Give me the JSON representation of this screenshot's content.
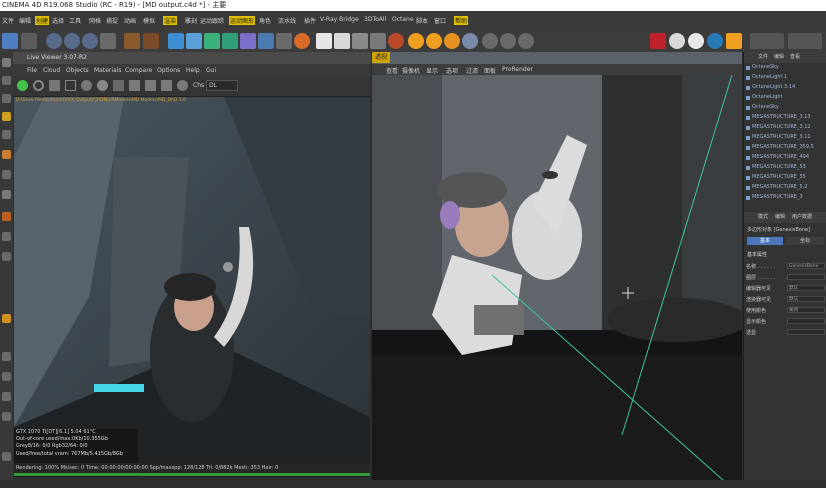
{
  "window": {
    "title": "CINEMA 4D R19.068 Studio (RC - R19) - [MD output.c4d *] - 主要"
  },
  "menubar": [
    {
      "label": "文件"
    },
    {
      "label": "编辑"
    },
    {
      "label": "创建",
      "highlight": true
    },
    {
      "label": "选择"
    },
    {
      "label": "工具"
    },
    {
      "label": "网格"
    },
    {
      "label": "捕捉"
    },
    {
      "label": "动画"
    },
    {
      "label": "模拟"
    },
    {
      "label": "渲染",
      "highlight": true
    },
    {
      "label": "雕刻"
    },
    {
      "label": "运动跟踪"
    },
    {
      "label": "运动图形",
      "highlight": true
    },
    {
      "label": "角色"
    },
    {
      "label": "流水线"
    },
    {
      "label": "插件"
    },
    {
      "label": "V-Ray Bridge"
    },
    {
      "label": "3DToAll"
    },
    {
      "label": "Octane"
    },
    {
      "label": "脚本"
    },
    {
      "label": "窗口"
    },
    {
      "label": "帮助",
      "highlight": true
    }
  ],
  "live_viewer": {
    "title": "Live Viewer 3.07-R2",
    "menu": [
      "File",
      "Cloud",
      "Objects",
      "Materials",
      "Compare",
      "Options",
      "Help",
      "Gui"
    ],
    "channel_label": "Chs",
    "channel_value": "DL",
    "path_overlay": "D:\\Save files\\octane\\OrbX_Outputs\\2\\DMod\\Models\\MD Models\\MD_Dl\\D 1.0",
    "stats": [
      "GTX 1070 Ti[DT][6.1]        5.04      61°C",
      "Out-of-core used/max:0Kb/10.355Gb",
      "Grey8/16: 0/0            Rgb32/64: 0/0",
      "Used/free/total vram: 767Mb/5.415Gb/8Gb"
    ],
    "status": "Rendering: 100%   Ms/sec: 0   Time: 00:00:00/00:00:00   Spp/maxspp: 128/128   Tri: 0/882k   Mesh: 353  Hair: 0"
  },
  "viewport": {
    "tab_label": "透视",
    "menu": [
      "查看",
      "摄像机",
      "显示",
      "选项",
      "过滤",
      "面板",
      "ProRender"
    ]
  },
  "object_manager": {
    "header": [
      "文件",
      "编辑",
      "查看"
    ],
    "items": [
      "OctaneSky",
      "OctaneLight 1",
      "OctaneLight 3.14",
      "OctaneLight",
      "OctaneSky",
      "MEGASTRUCTURE_3.13",
      "MEGASTRUCTURE_3.12",
      "MEGASTRUCTURE_3.11",
      "MEGASTRUCTURE_359.5",
      "MEGASTRUCTURE_494",
      "MEGASTRUCTURE_53",
      "MEGASTRUCTURE_55",
      "MEGASTRUCTURE_5.2",
      "MEGASTRUCTURE_3"
    ]
  },
  "attributes": {
    "header": [
      "模式",
      "编辑",
      "用户数据"
    ],
    "object_label": "多边形对象 [GenesisBone]",
    "tabs": [
      "基本",
      "坐标"
    ],
    "section": "基本属性",
    "rows": [
      {
        "label": "名称 . . . . . .",
        "value": "GenesisBone"
      },
      {
        "label": "图层 . . . . . .",
        "value": ""
      },
      {
        "label": "编辑器可见",
        "value": "默认"
      },
      {
        "label": "渲染器可见",
        "value": "默认"
      },
      {
        "label": "使用颜色",
        "value": "关闭"
      },
      {
        "label": "显示颜色",
        "value": ""
      },
      {
        "label": "透显",
        "value": ""
      }
    ]
  },
  "colors": {
    "accent": "#e0c000",
    "selection": "#4a78b8",
    "progress": "#2f9b3a"
  }
}
